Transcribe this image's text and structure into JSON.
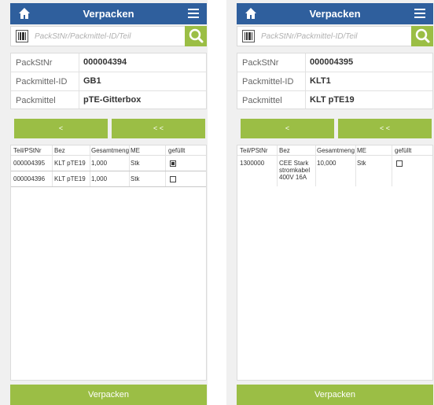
{
  "header": {
    "title": "Verpacken"
  },
  "search": {
    "placeholder": "PackStNr/Packmittel-ID/Teil"
  },
  "nav": {
    "prev_label": "<",
    "first_label": "< <"
  },
  "grid_columns": [
    "Teil/PStNr",
    "Bez",
    "Gesamtmenge",
    "ME",
    "gefüllt"
  ],
  "footer": {
    "button_label": "Verpacken"
  },
  "colors": {
    "header_bg": "#2f5f9d",
    "accent_green": "#9bbe45",
    "page_bg": "#f0f0f0"
  },
  "icons": {
    "home": "home-icon",
    "menu": "hamburger-menu-icon",
    "barcode": "barcode-icon",
    "search": "search-icon"
  },
  "screens": [
    {
      "packstnr_label": "PackStNr",
      "packstnr_value": "000004394",
      "packmittel_id_label": "Packmittel-ID",
      "packmittel_id_value": "GB1",
      "packmittel_label": "Packmittel",
      "packmittel_value": "pTE-Gitterbox",
      "rows": [
        {
          "teil": "000004395",
          "bez": "KLT pTE19",
          "menge": "1,000",
          "me": "Stk",
          "gefuellt": true
        },
        {
          "teil": "000004396",
          "bez": "KLT pTE19",
          "menge": "1,000",
          "me": "Stk",
          "gefuellt": false
        }
      ]
    },
    {
      "packstnr_label": "PackStNr",
      "packstnr_value": "000004395",
      "packmittel_id_label": "Packmittel-ID",
      "packmittel_id_value": "KLT1",
      "packmittel_label": "Packmittel",
      "packmittel_value": "KLT pTE19",
      "rows": [
        {
          "teil": "1300000",
          "bez_lines": [
            "CEE Stark",
            "stromkabel",
            "400V 16A"
          ],
          "menge": "10,000",
          "me": "Stk",
          "gefuellt": false
        }
      ]
    }
  ]
}
